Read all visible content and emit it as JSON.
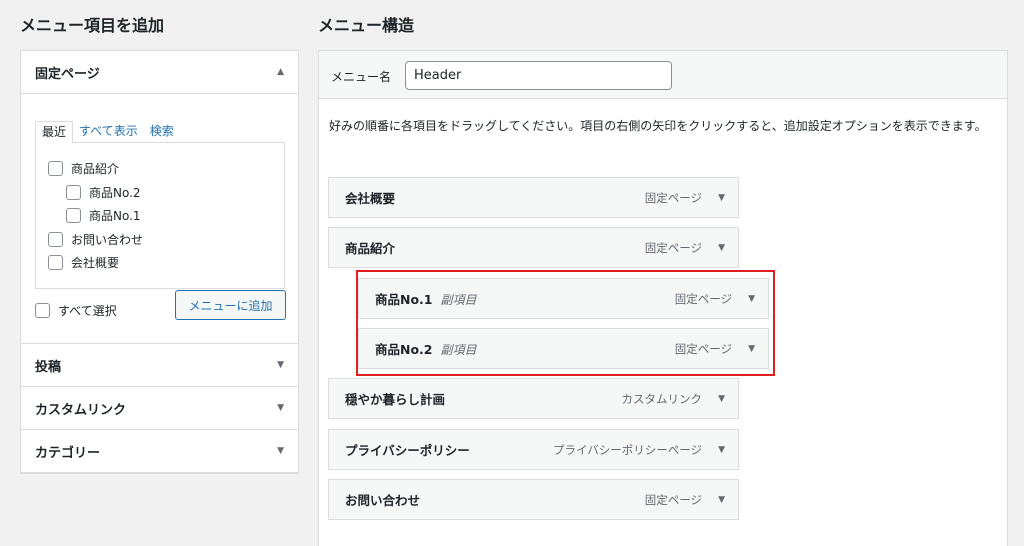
{
  "left_heading": "メニュー項目を追加",
  "right_heading": "メニュー構造",
  "pages_panel": {
    "title": "固定ページ",
    "tabs": [
      "最近",
      "すべて表示",
      "検索"
    ],
    "items": [
      "商品紹介",
      "商品No.2",
      "商品No.1",
      "お問い合わせ",
      "会社概要"
    ],
    "select_all": "すべて選択",
    "add_button": "メニューに追加"
  },
  "accordion": [
    "投稿",
    "カスタムリンク",
    "カテゴリー"
  ],
  "menu_name": {
    "label": "メニュー名",
    "value": "Header"
  },
  "instructions": "好みの順番に各項目をドラッグしてください。項目の右側の矢印をクリックすると、追加設定オプションを表示できます。",
  "menu_items": [
    {
      "title": "会社概要",
      "sub": "",
      "type": "固定ページ"
    },
    {
      "title": "商品紹介",
      "sub": "",
      "type": "固定ページ"
    },
    {
      "title": "商品No.1",
      "sub": "副項目",
      "type": "固定ページ"
    },
    {
      "title": "商品No.2",
      "sub": "副項目",
      "type": "固定ページ"
    },
    {
      "title": "穏やか暮らし計画",
      "sub": "",
      "type": "カスタムリンク"
    },
    {
      "title": "プライバシーポリシー",
      "sub": "",
      "type": "プライバシーポリシーページ"
    },
    {
      "title": "お問い合わせ",
      "sub": "",
      "type": "固定ページ"
    }
  ],
  "colors": {
    "highlight": "#e0201f",
    "link": "#2271b1"
  },
  "icons": {
    "collapse": "triangle-up-icon",
    "expand": "triangle-down-icon"
  }
}
